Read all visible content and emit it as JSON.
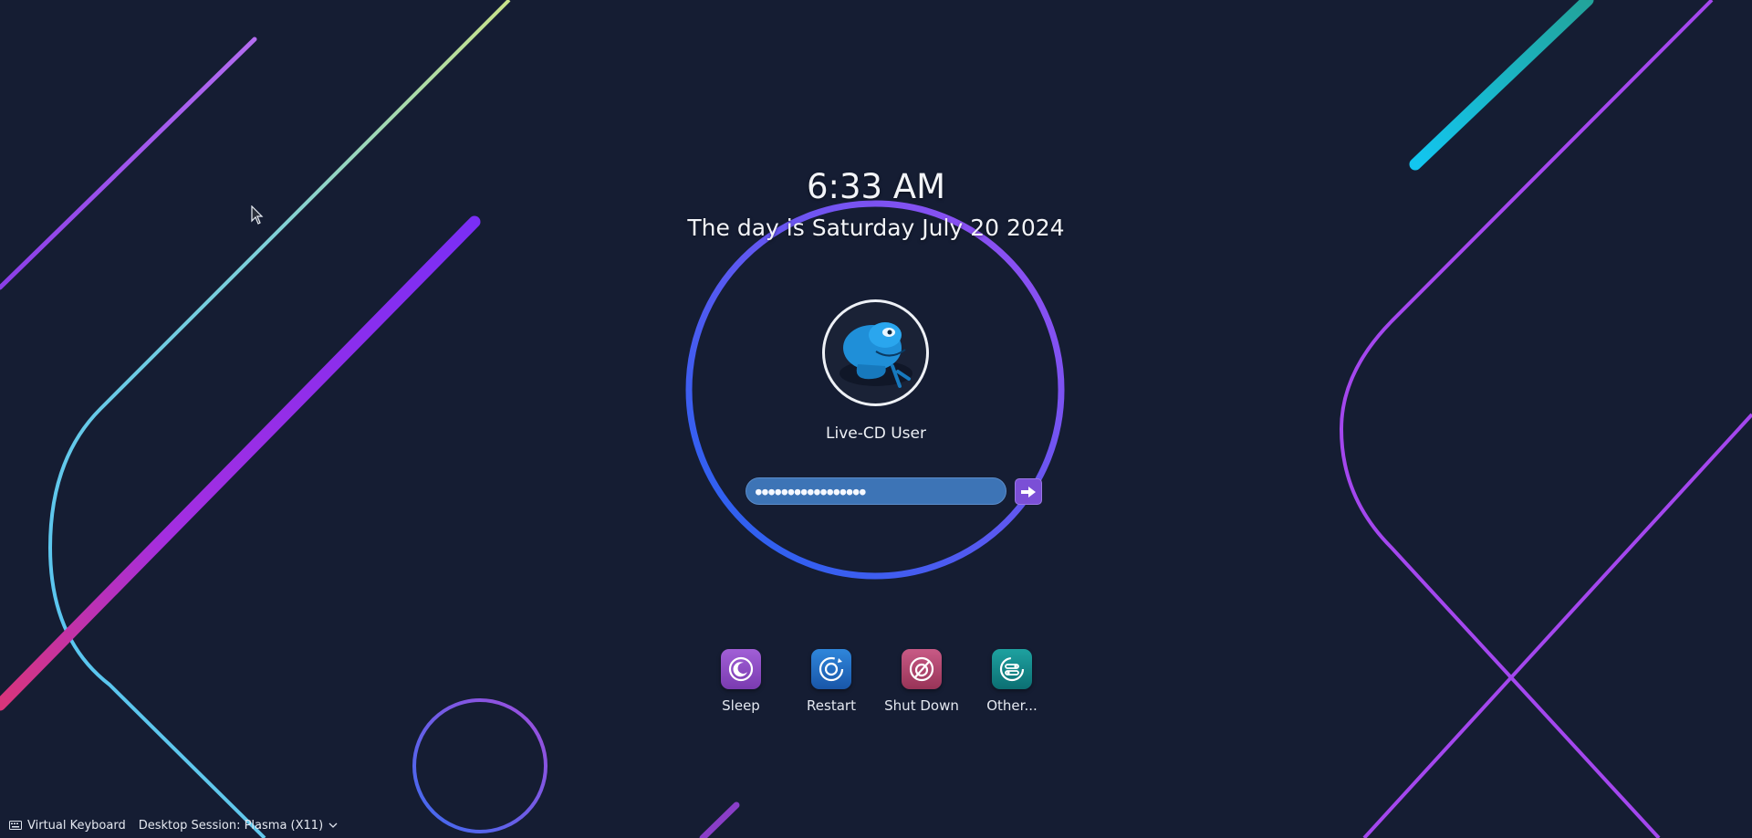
{
  "lock": {
    "time": "6:33 AM",
    "date": "The day is Saturday July 20 2024"
  },
  "user": {
    "name": "Live-CD User",
    "avatar_icon": "chameleon-avatar-icon"
  },
  "password": {
    "masked_value": "●●●●●●●●●●●●●●●●●"
  },
  "login_icon": "arrow-right-icon",
  "actions": [
    {
      "label": "Sleep",
      "icon": "sleep-icon",
      "color": "#8a4bbf"
    },
    {
      "label": "Restart",
      "icon": "restart-icon",
      "color": "#2067b8"
    },
    {
      "label": "Shut Down",
      "icon": "shutdown-icon",
      "color": "#b2406a"
    },
    {
      "label": "Other...",
      "icon": "switch-user-icon",
      "color": "#108585"
    }
  ],
  "bottombar": {
    "virtual_keyboard": "Virtual Keyboard",
    "session": "Desktop Session: Plasma (X11)"
  },
  "colors": {
    "background": "#151d33",
    "accent_purple": "#9b4df2",
    "accent_blue": "#1f63f0",
    "field_blue": "#3d74b6"
  }
}
